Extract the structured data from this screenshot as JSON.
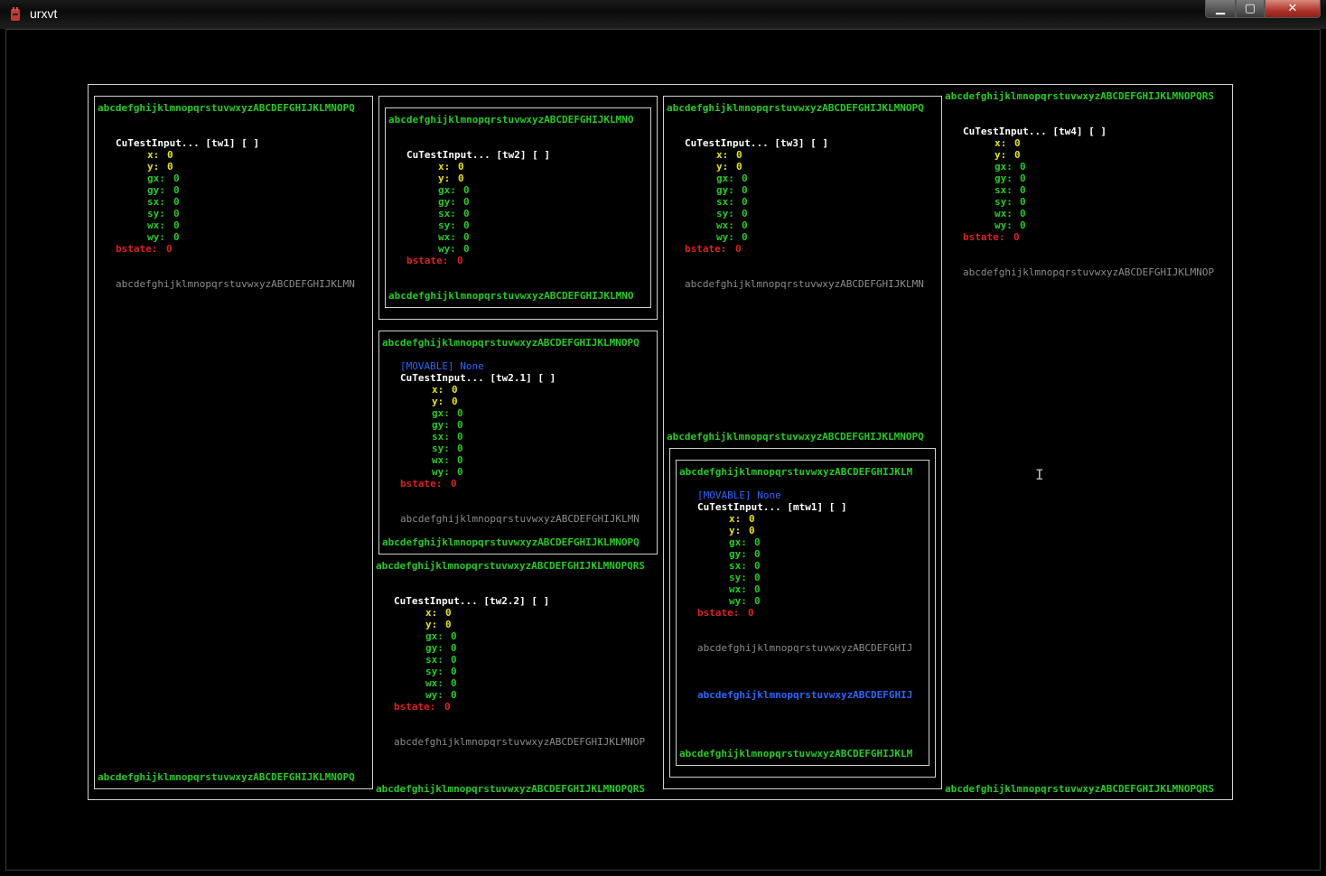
{
  "window": {
    "title": "urxvt",
    "min_label": "▁",
    "max_label": "▢",
    "close_label": "✕"
  },
  "icons": {
    "app": "terminal-app-icon",
    "cursor": "ibeam-cursor-icon"
  },
  "colors": {
    "border": "#d0d0d0",
    "green": "#22cc22",
    "yellow": "#e6e600",
    "red": "#e02020",
    "gray": "#8c8c8c",
    "blue": "#2a66ff"
  },
  "labels": {
    "alpha_47": "abcdefghijklmnopqrstuvwxyzABCDEFGHIJKLMNOPQ",
    "alpha_45": "abcdefghijklmnopqrstuvwxyzABCDEFGHIJKLMNO",
    "alpha_49": "abcdefghijklmnopqrstuvwxyzABCDEFGHIJKLMNOPQRS",
    "alpha_40": "abcdefghijklmnopqrstuvwxyzABCDEFGHIJKLM",
    "movable": "[MOVABLE] None"
  },
  "widgets": {
    "tw1": {
      "header": "CuTestInput... [tw1] [ ]",
      "x": "0",
      "y": "0",
      "gx": "0",
      "gy": "0",
      "sx": "0",
      "sy": "0",
      "wx": "0",
      "wy": "0",
      "bstate": "0",
      "gray": "abcdefghijklmnopqrstuvwxyzABCDEFGHIJKLMN"
    },
    "tw2": {
      "header": "CuTestInput... [tw2] [ ]",
      "x": "0",
      "y": "0",
      "gx": "0",
      "gy": "0",
      "sx": "0",
      "sy": "0",
      "wx": "0",
      "wy": "0",
      "bstate": "0"
    },
    "tw3": {
      "header": "CuTestInput... [tw3] [ ]",
      "x": "0",
      "y": "0",
      "gx": "0",
      "gy": "0",
      "sx": "0",
      "sy": "0",
      "wx": "0",
      "wy": "0",
      "bstate": "0",
      "gray": "abcdefghijklmnopqrstuvwxyzABCDEFGHIJKLMN"
    },
    "tw4": {
      "header": "CuTestInput... [tw4] [ ]",
      "x": "0",
      "y": "0",
      "gx": "0",
      "gy": "0",
      "sx": "0",
      "sy": "0",
      "wx": "0",
      "wy": "0",
      "bstate": "0",
      "gray": "abcdefghijklmnopqrstuvwxyzABCDEFGHIJKLMNOP"
    },
    "tw21": {
      "header": "CuTestInput... [tw2.1] [ ]",
      "x": "0",
      "y": "0",
      "gx": "0",
      "gy": "0",
      "sx": "0",
      "sy": "0",
      "wx": "0",
      "wy": "0",
      "bstate": "0",
      "gray": "abcdefghijklmnopqrstuvwxyzABCDEFGHIJKLMN"
    },
    "tw22": {
      "header": "CuTestInput... [tw2.2] [ ]",
      "x": "0",
      "y": "0",
      "gx": "0",
      "gy": "0",
      "sx": "0",
      "sy": "0",
      "wx": "0",
      "wy": "0",
      "bstate": "0",
      "gray": "abcdefghijklmnopqrstuvwxyzABCDEFGHIJKLMNOP"
    },
    "mtw1": {
      "header": "CuTestInput... [mtw1] [ ]",
      "x": "0",
      "y": "0",
      "gx": "0",
      "gy": "0",
      "sx": "0",
      "sy": "0",
      "wx": "0",
      "wy": "0",
      "bstate": "0",
      "gray": "abcdefghijklmnopqrstuvwxyzABCDEFGHIJ",
      "blue": "abcdefghijklmnopqrstuvwxyzABCDEFGHIJ"
    }
  },
  "field_labels": {
    "x": "x:",
    "y": "y:",
    "gx": "gx:",
    "gy": "gy:",
    "sx": "sx:",
    "sy": "sy:",
    "wx": "wx:",
    "wy": "wy:",
    "bstate": "bstate:"
  }
}
